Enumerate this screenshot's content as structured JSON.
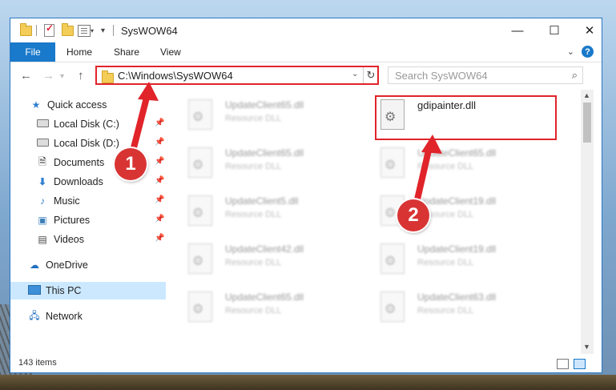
{
  "window": {
    "title": "SysWOW64",
    "controls": {
      "minimize": "—",
      "maximize": "☐",
      "close": "✕"
    }
  },
  "ribbon": {
    "tabs": [
      "File",
      "Home",
      "Share",
      "View"
    ],
    "help": "?"
  },
  "address_bar": {
    "path": "C:\\Windows\\SysWOW64"
  },
  "search": {
    "placeholder": "Search SysWOW64"
  },
  "sidebar": {
    "items": [
      {
        "label": "Quick access",
        "icon": "star-icon"
      },
      {
        "label": "Local Disk (C:)",
        "icon": "drive-icon",
        "pinned": true
      },
      {
        "label": "Local Disk (D:)",
        "icon": "drive-icon",
        "pinned": true
      },
      {
        "label": "Documents",
        "icon": "documents-icon",
        "pinned": true
      },
      {
        "label": "Downloads",
        "icon": "download-icon",
        "pinned": true
      },
      {
        "label": "Music",
        "icon": "music-icon",
        "pinned": true
      },
      {
        "label": "Pictures",
        "icon": "pictures-icon",
        "pinned": true
      },
      {
        "label": "Videos",
        "icon": "videos-icon",
        "pinned": true
      },
      {
        "label": "OneDrive",
        "icon": "cloud-icon"
      },
      {
        "label": "This PC",
        "icon": "computer-icon",
        "selected": true
      },
      {
        "label": "Network",
        "icon": "network-icon"
      }
    ]
  },
  "files": {
    "left_column": [
      {
        "name": "UpdateClient65.dll",
        "type": "Resource DLL"
      },
      {
        "name": "UpdateClient65.dll",
        "type": "Resource DLL"
      },
      {
        "name": "UpdateClient5.dll",
        "type": "Resource DLL"
      },
      {
        "name": "UpdateClient42.dll",
        "type": "Resource DLL"
      },
      {
        "name": "UpdateClient65.dll",
        "type": "Resource DLL"
      }
    ],
    "right_column": [
      {
        "name": "gdipainter.dll",
        "type": ""
      },
      {
        "name": "UpdateClient65.dll",
        "type": "Resource DLL"
      },
      {
        "name": "UpdateClient19.dll",
        "type": "Resource DLL"
      },
      {
        "name": "UpdateClient19.dll",
        "type": "Resource DLL"
      },
      {
        "name": "UpdateClient63.dll",
        "type": "Resource DLL"
      }
    ]
  },
  "status": {
    "item_count": "143 items"
  },
  "annotations": {
    "step1": "1",
    "step2": "2",
    "highlight_color": "#e0242a",
    "badge_color": "#d93434"
  }
}
